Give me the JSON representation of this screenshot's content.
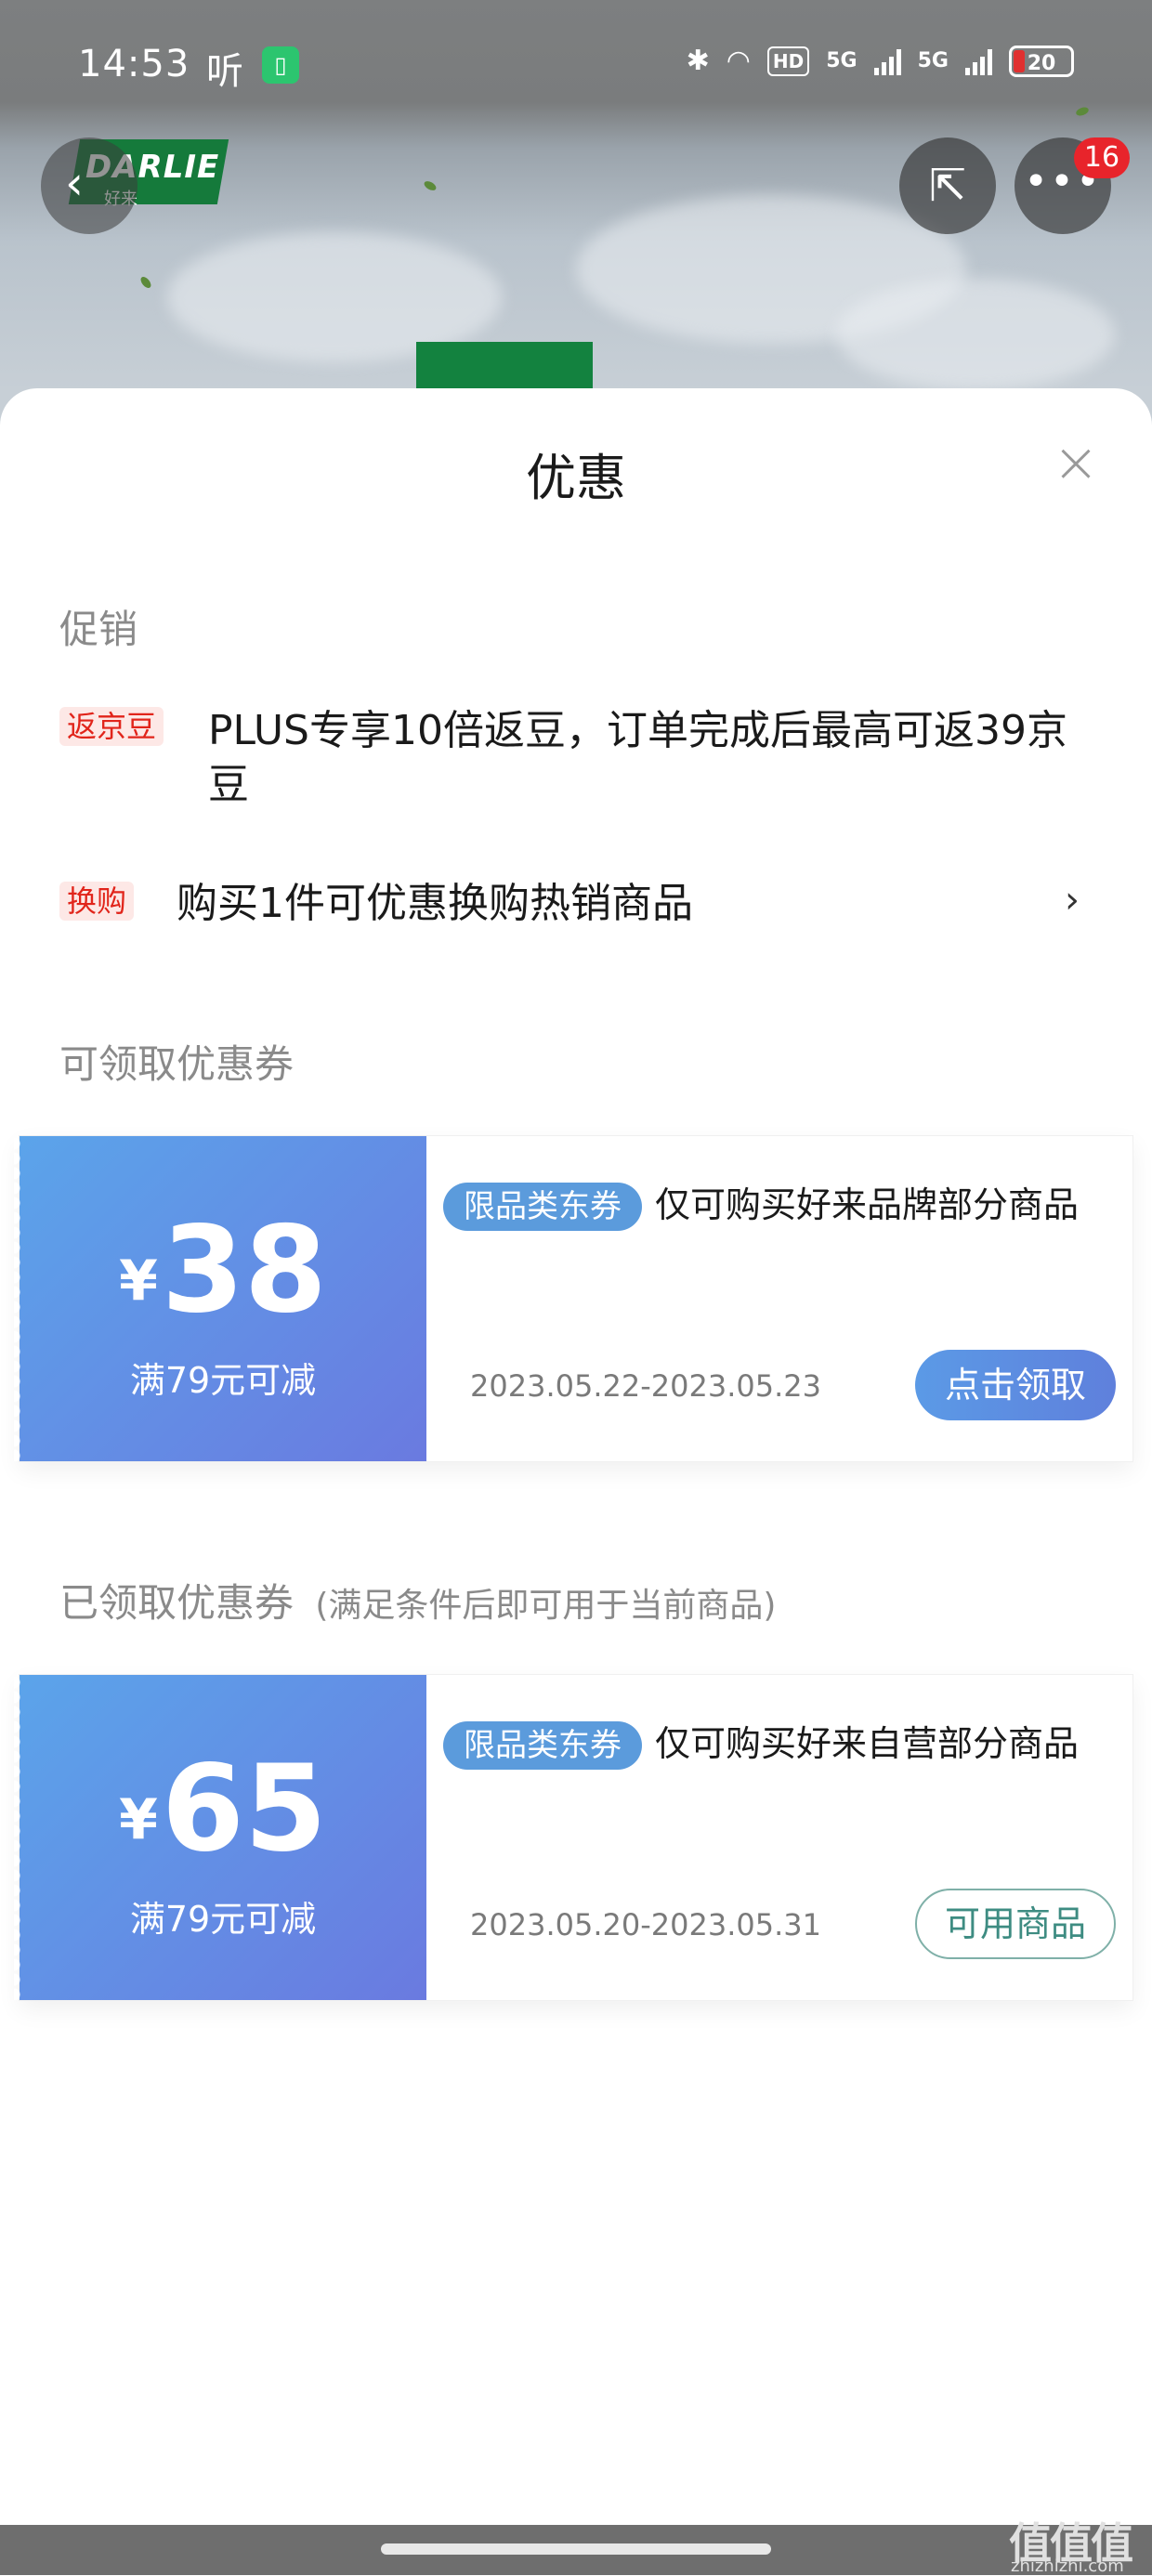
{
  "status_bar": {
    "time": "14:53",
    "ting": "听",
    "hd": "HD",
    "network_1": "5G",
    "network_2": "5G",
    "battery": "20"
  },
  "header": {
    "brand_logo": "DARLIE",
    "brand_logo_sub": "好来",
    "badge_count": "16",
    "back_icon": "chevron-left-icon",
    "share_icon": "share-icon",
    "more_icon": "more-icon"
  },
  "sheet": {
    "title": "优惠",
    "close_icon": "close-icon"
  },
  "promotions": {
    "section_label": "促销",
    "items": [
      {
        "tag": "返京豆",
        "text": "PLUS专享10倍返豆，订单完成后最高可返39京豆"
      },
      {
        "tag": "换购",
        "text": "购买1件可优惠换购热销商品",
        "chevron": "›"
      }
    ]
  },
  "available_coupons": {
    "section_label": "可领取优惠券",
    "coupons": [
      {
        "currency": "¥",
        "amount": "38",
        "condition": "满79元可减",
        "tag": "限品类东券",
        "desc": "仅可购买好来品牌部分商品",
        "date": "2023.05.22-2023.05.23",
        "action": "点击领取"
      }
    ]
  },
  "claimed_coupons": {
    "section_label": "已领取优惠券",
    "section_note": "(满足条件后即可用于当前商品)",
    "coupons": [
      {
        "currency": "¥",
        "amount": "65",
        "condition": "满79元可减",
        "tag": "限品类东券",
        "desc": "仅可购买好来自营部分商品",
        "date": "2023.05.20-2023.05.31",
        "action": "可用商品"
      }
    ]
  },
  "watermark": {
    "text": "值值值",
    "sub": "zhizhizhi.com"
  },
  "colors": {
    "coupon_gradient_start": "#5ba4ea",
    "coupon_gradient_end": "#6a7ae0",
    "tag_red": "#e1251b",
    "tag_blue": "#5b9bdc"
  }
}
